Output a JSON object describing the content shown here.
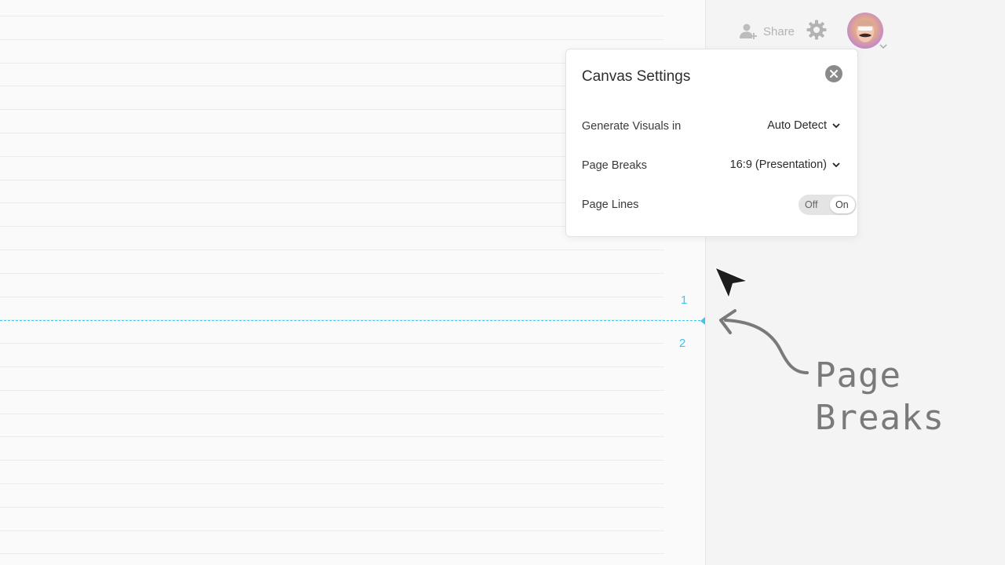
{
  "canvas": {
    "page_numbers": [
      "1",
      "2"
    ]
  },
  "toolbar": {
    "share_label": "Share"
  },
  "popover": {
    "title": "Canvas Settings",
    "rows": {
      "generate": {
        "label": "Generate Visuals in",
        "value": "Auto Detect"
      },
      "breaks": {
        "label": "Page Breaks",
        "value": "16:9 (Presentation)"
      },
      "lines": {
        "label": "Page Lines",
        "off_label": "Off",
        "on_label": "On",
        "state": "On"
      }
    }
  },
  "annotation": {
    "line1": "Page",
    "line2": "Breaks"
  },
  "colors": {
    "page_break": "#3fc4ee",
    "icon_gray": "#b3b3b3",
    "annotation": "#7a7a7a"
  },
  "icons": {
    "share": "add-user-icon",
    "settings": "gear-icon",
    "close": "close-icon",
    "dropdown": "chevron-down-icon",
    "cursor": "mouse-pointer-icon"
  }
}
